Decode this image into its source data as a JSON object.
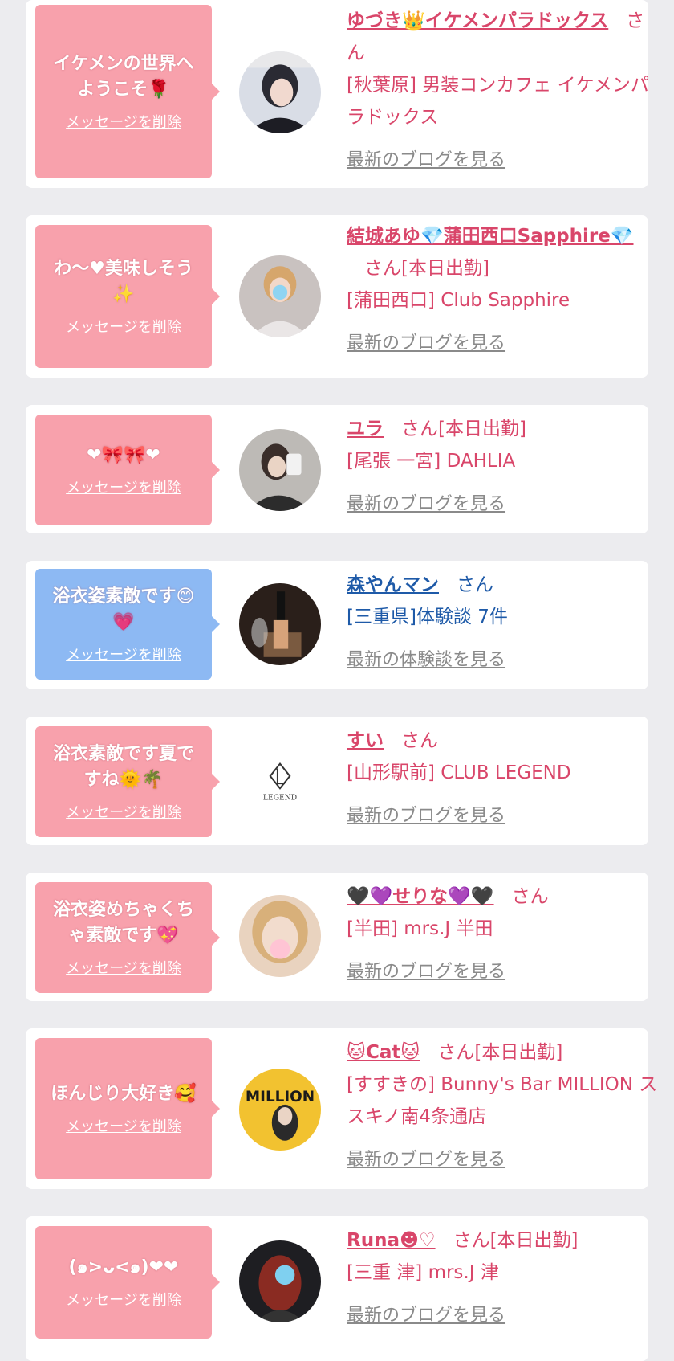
{
  "delete_label": "メッセージを削除",
  "san": "さん",
  "colors": {
    "pink_bubble": "#f8a1ac",
    "blue_bubble": "#8db9f3",
    "pink_text": "#d9466a",
    "blue_text": "#1e5aa8",
    "gray_link": "#8a8a8a"
  },
  "cards": [
    {
      "message_line1": "イケメンの世界へ",
      "message_line2": "ようこそ🌹",
      "name": "ゆづき👑イケメンパラドックス",
      "status": "",
      "shop": "[秋葉原] 男装コンカフェ イケメンパラドックス",
      "link": "最新のブログを見る"
    },
    {
      "message_line1": "わ〜♥美味しそう",
      "message_line2": "✨",
      "name": "結城あゆ💎蒲田西口Sapphire💎",
      "status": "[本日出勤]",
      "shop": "[蒲田西口] Club Sapphire",
      "link": "最新のブログを見る"
    },
    {
      "message_line1": "❤🎀🎀❤",
      "message_line2": "",
      "name": "ユラ",
      "status": "[本日出勤]",
      "shop": "[尾張 一宮] DAHLIA",
      "link": "最新のブログを見る"
    },
    {
      "message_line1": "浴衣姿素敵です😊",
      "message_line2": "💗",
      "name": "森やんマン",
      "status": "",
      "shop": "[三重県]体験談 7件",
      "link": "最新の体験談を見る"
    },
    {
      "message_line1": "浴衣素敵です夏で",
      "message_line2": "すね🌞🌴",
      "name": "すい",
      "status": "",
      "shop": "[山形駅前] CLUB LEGEND",
      "link": "最新のブログを見る",
      "logo_text": "LEGEND"
    },
    {
      "message_line1": "浴衣姿めちゃくち",
      "message_line2": "ゃ素敵です💖",
      "name": "🖤💜せりな💜🖤",
      "status": "",
      "shop": "[半田] mrs.J 半田",
      "link": "最新のブログを見る"
    },
    {
      "message_line1": "ほんじり大好き🥰",
      "message_line2": "",
      "name": "🐱Cat🐱",
      "status": "[本日出勤]",
      "shop": "[すすきの] Bunny's Bar MILLION ススキノ南4条通店",
      "link": "最新のブログを見る",
      "logo_text": "MILLION"
    },
    {
      "message_line1": "(๑>ᴗ<๑)❤❤",
      "message_line2": "",
      "name": "Runa☻♡",
      "status": "[本日出勤]",
      "shop": "[三重 津] mrs.J 津",
      "link": "最新のブログを見る"
    }
  ]
}
